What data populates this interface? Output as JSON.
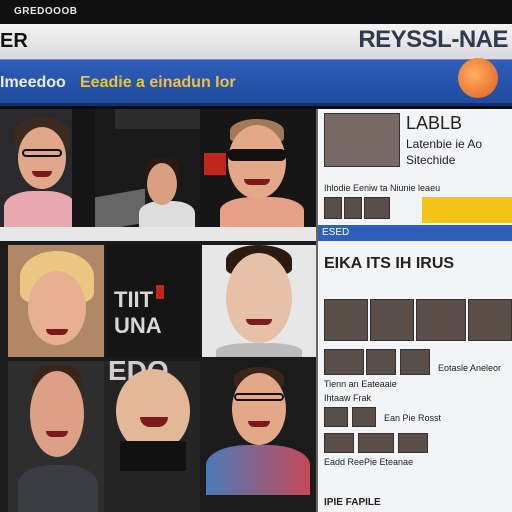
{
  "window": {
    "top_label": "GREDOOOB"
  },
  "header": {
    "left_title": "ER",
    "brand": "REYSSL-NAE"
  },
  "navbar": {
    "title_white": "Imeedoo",
    "title_yellow": "Eeadie a einadun Ior"
  },
  "grid": {
    "tiles": [
      {
        "name": "tile-1"
      },
      {
        "name": "tile-2"
      },
      {
        "name": "tile-3"
      },
      {
        "name": "tile-4"
      },
      {
        "name": "tile-5",
        "label": "TIIT UNA"
      },
      {
        "name": "tile-6"
      },
      {
        "name": "tile-7"
      },
      {
        "name": "tile-8",
        "label": "EDO"
      },
      {
        "name": "tile-9"
      }
    ]
  },
  "sidebar": {
    "headline": "LABLB",
    "sub1": "Latenbie ie Ao",
    "sub2": "Sitechide",
    "caption1": "Ihlodie Eeniw ta Niunie leaeu",
    "toolbar_label": "ESED",
    "section_title": "EIKA ITS IH IRUS",
    "row_caption1": "Tienn an Eateaaie",
    "row_caption2": "Eotasle Aneleor",
    "row_caption3": "Ihtaaw Frak",
    "row_caption4": "Ean Pie Rosst",
    "row_caption5": "Eadd ReePie Eteanae",
    "bottom_label": "IPIE FAPILE"
  },
  "colors": {
    "accent_blue": "#2f5fb8",
    "accent_yellow": "#f0c040",
    "orange_orb": "#e05a1c"
  }
}
